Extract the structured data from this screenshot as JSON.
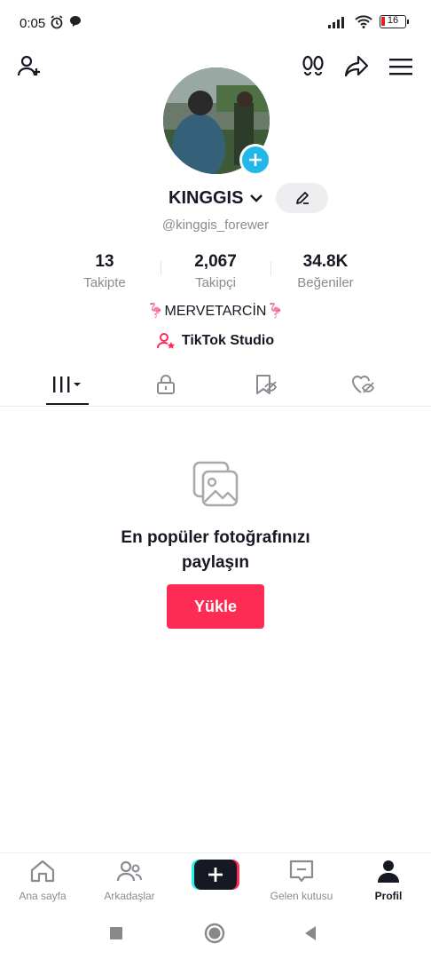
{
  "status_bar": {
    "time": "0:05",
    "battery": "16"
  },
  "profile": {
    "username": "KINGGIS",
    "handle": "@kinggis_forewer",
    "stats": [
      {
        "value": "13",
        "label": "Takipte"
      },
      {
        "value": "2,067",
        "label": "Takipçi"
      },
      {
        "value": "34.8K",
        "label": "Beğeniler"
      }
    ],
    "bio": "🦩MERVETARCİN🦩",
    "studio_label": "TikTok Studio"
  },
  "empty_state": {
    "title_line1": "En popüler fotoğrafınızı",
    "title_line2": "paylaşın",
    "upload_label": "Yükle"
  },
  "bottom_nav": {
    "home": "Ana sayfa",
    "friends": "Arkadaşlar",
    "inbox": "Gelen kutusu",
    "profile": "Profil"
  },
  "colors": {
    "accent": "#fe2c55",
    "avatar_badge": "#1fb8e8"
  }
}
